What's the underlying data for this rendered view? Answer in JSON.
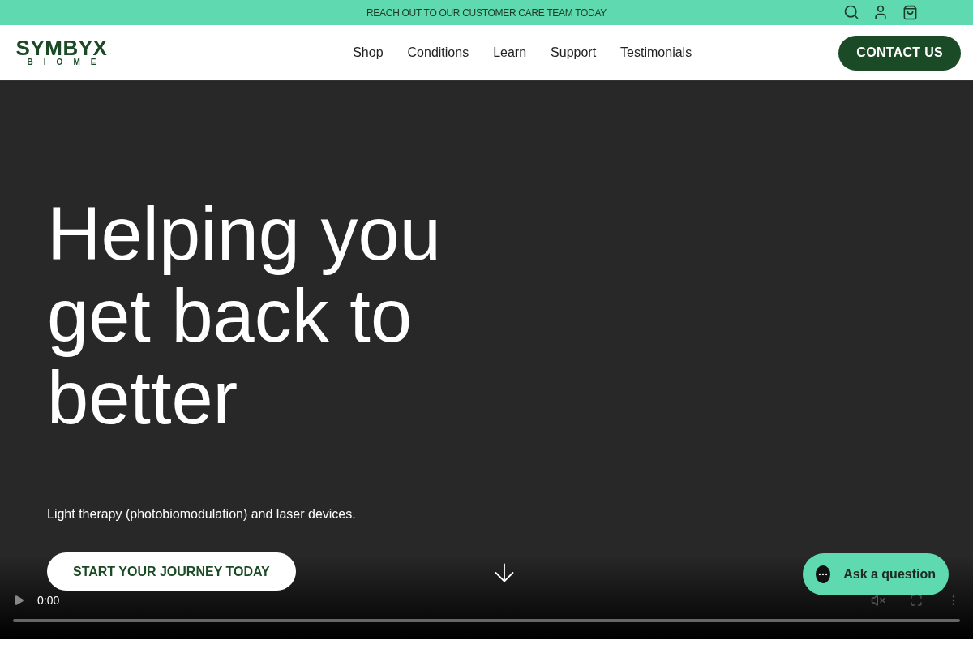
{
  "announcement": "REACH OUT TO OUR CUSTOMER CARE TEAM TODAY",
  "logo": {
    "name": "SYMBYX",
    "sub": "BIOME"
  },
  "nav": [
    "Shop",
    "Conditions",
    "Learn",
    "Support",
    "Testimonials"
  ],
  "contact_button": "CONTACT US",
  "hero": {
    "heading_lines": [
      "Helping you",
      "get back to",
      "better"
    ],
    "subtitle": "Light therapy (photobiomodulation) and laser devices.",
    "cta": "START YOUR JOURNEY TODAY"
  },
  "video": {
    "time": "0:00",
    "muted": true
  },
  "chat": {
    "label": "Ask a question"
  }
}
